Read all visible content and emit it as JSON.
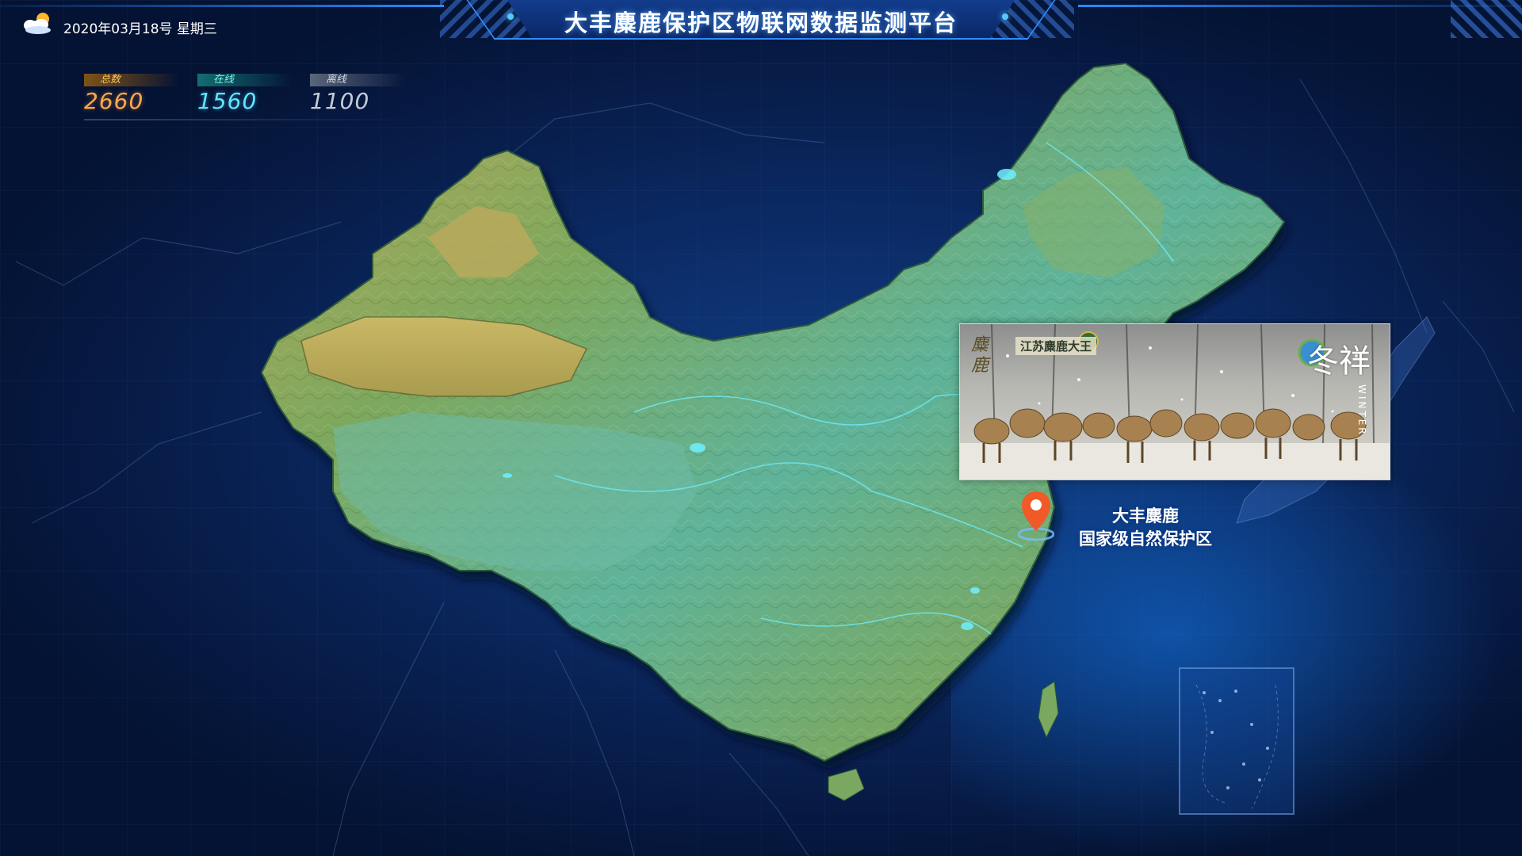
{
  "header": {
    "title": "大丰麋鹿保护区物联网数据监测平台",
    "date": "2020年03月18号",
    "weekday": "星期三",
    "weather_icon": "cloud-sun-icon"
  },
  "stats": {
    "total": {
      "label": "总数",
      "value": "2660"
    },
    "online": {
      "label": "在线",
      "value": "1560"
    },
    "offline": {
      "label": "离线",
      "value": "1100"
    }
  },
  "photo": {
    "side_text": "麋鹿",
    "logo_text": "江苏麋鹿大王",
    "right_text": "冬祥",
    "vertical_text": "WINTER"
  },
  "location": {
    "line1": "大丰麋鹿",
    "line2": "国家级自然保护区",
    "pin_icon": "location-pin-icon"
  },
  "colors": {
    "accent": "#2f8cff",
    "total": "#ffa94d",
    "online": "#5fe7ff",
    "offline": "#c6ccd6",
    "pin": "#f05a28"
  }
}
